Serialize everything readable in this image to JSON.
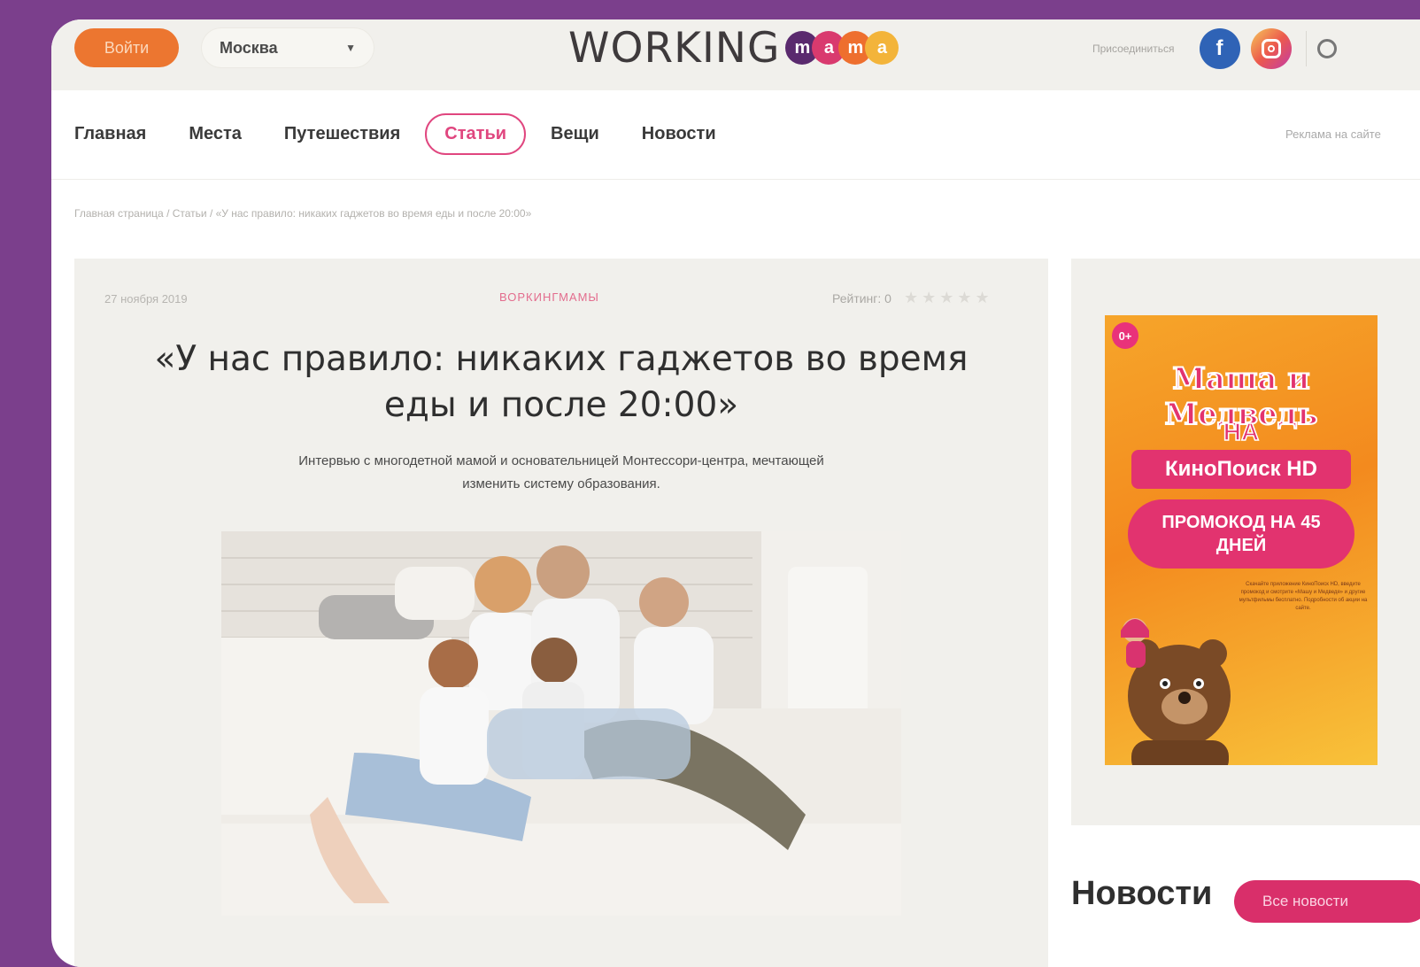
{
  "header": {
    "login_label": "Войти",
    "city": "Москва",
    "logo_text": "WORKING",
    "logo_letters": [
      "m",
      "a",
      "m",
      "a"
    ],
    "logo_colors": [
      "#5a2a6e",
      "#d93a6e",
      "#ee6f2e",
      "#f3b43a"
    ],
    "join_link": "Присоединиться",
    "facebook_glyph": "f"
  },
  "nav": {
    "items": [
      "Главная",
      "Места",
      "Путешествия",
      "Статьи",
      "Вещи",
      "Новости"
    ],
    "active_index": 3,
    "ad_link": "Реклама на сайте"
  },
  "breadcrumb": "Главная страница / Статьи / «У нас правило: никаких гаджетов во время еды и после 20:00»",
  "article": {
    "date": "27 ноября 2019",
    "category": "ВОРКИНГМАМЫ",
    "rating_label": "Рейтинг: 0",
    "rating_value": 0,
    "rating_max": 5,
    "title": "«У нас правило: никаких гаджетов во время еды и после 20:00»",
    "lead": "Интервью с многодетной мамой и основательницей Монтессори-центра, мечтающей изменить систему образования."
  },
  "sidebar_ad": {
    "age": "0+",
    "title": "Маша и Медведь",
    "na": "НА",
    "service": "КиноПоиск HD",
    "promo": "ПРОМОКОД НА 45 ДНЕЙ",
    "fine_print": "Скачайте приложение КиноПоиск HD, введите промокод и смотрите «Машу и Медведя» и другие мультфильмы бесплатно. Подробности об акции на сайте."
  },
  "news": {
    "heading": "Новости",
    "all_button": "Все новости"
  },
  "colors": {
    "accent_pink": "#e0467f",
    "login_orange": "#ec7630",
    "page_background": "#7b3f8c"
  }
}
